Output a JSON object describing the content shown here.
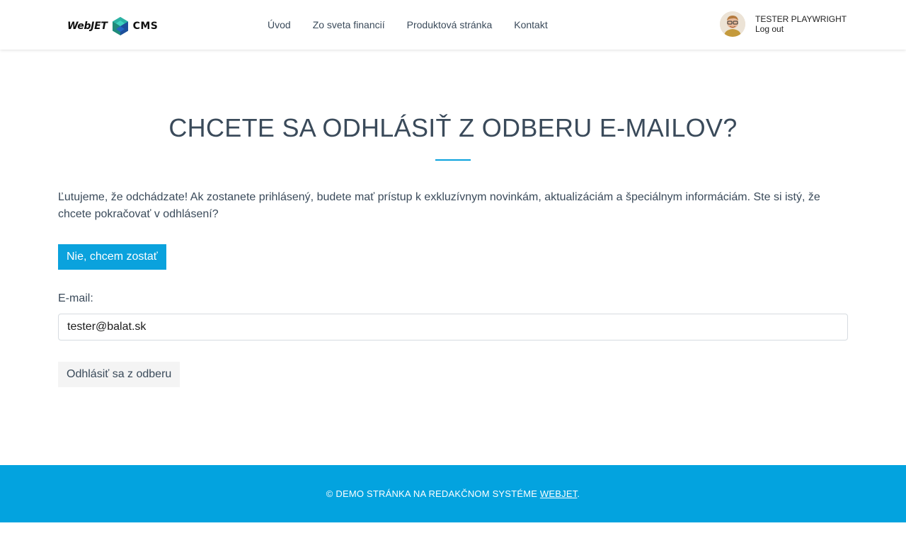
{
  "header": {
    "logo": {
      "left": "WebJET",
      "right": "CMS"
    },
    "nav": [
      {
        "label": "Úvod"
      },
      {
        "label": "Zo sveta financií"
      },
      {
        "label": "Produktová stránka"
      },
      {
        "label": "Kontakt"
      }
    ],
    "user": {
      "name": "TESTER PLAYWRIGHT",
      "logout": "Log out",
      "avatar_icon": "avatar"
    }
  },
  "main": {
    "title": "CHCETE SA ODHLÁSIŤ Z ODBERU E-MAILOV?",
    "lead": "Ľutujeme, že odchádzate! Ak zostanete prihlásený, budete mať prístup k exkluzívnym novinkám, aktualizáciám a špeciálnym informáciám. Ste si istý, že chcete pokračovať v odhlásení?",
    "stay_button": "Nie, chcem zostať",
    "email_label": "E-mail:",
    "email_value": "tester@balat.sk",
    "unsubscribe_button": "Odhlásiť sa z odberu"
  },
  "footer": {
    "prefix": "© DEMO STRÁNKA NA REDAKČNOM SYSTÉME ",
    "link": "WEBJET",
    "suffix": "."
  },
  "colors": {
    "accent": "#0aa2dd",
    "footer_bg": "#03a3df",
    "text": "#3a4a5a"
  }
}
